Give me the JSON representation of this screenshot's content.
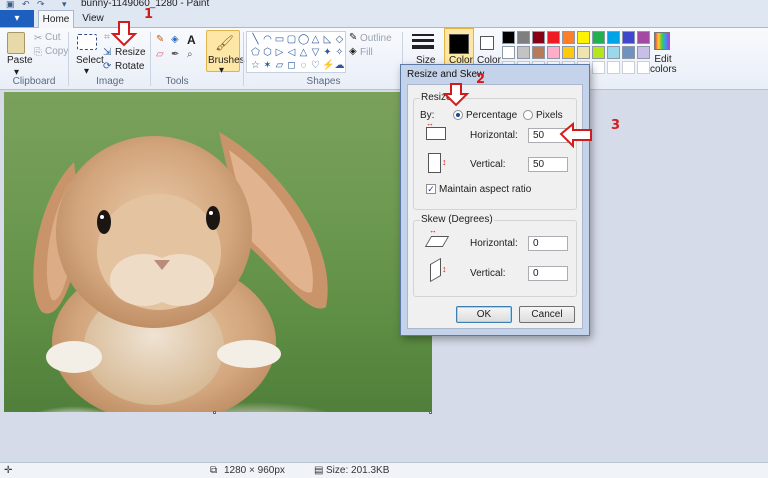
{
  "window": {
    "title": "bunny-1149060_1280 - Paint"
  },
  "tabs": {
    "file_label": "▾",
    "home": "Home",
    "view": "View"
  },
  "ribbon": {
    "clipboard": {
      "paste": "Paste",
      "cut": "Cut",
      "copy": "Copy",
      "label": "Clipboard"
    },
    "image": {
      "select": "Select",
      "crop_icon": "crop-icon",
      "resize": "Resize",
      "rotate": "Rotate",
      "label": "Image"
    },
    "tools": {
      "label": "Tools"
    },
    "brushes": {
      "label": "Brushes"
    },
    "shapes": {
      "outline": "Outline",
      "fill": "Fill",
      "label": "Shapes"
    },
    "size": {
      "label": "Size"
    },
    "colors": {
      "color1": "Color",
      "color2": "Color",
      "edit": "Edit colors",
      "row1": [
        "#000000",
        "#7f7f7f",
        "#880015",
        "#ed1c24",
        "#ff7f27",
        "#fff200",
        "#22b14c",
        "#00a2e8",
        "#3f48cc",
        "#a349a4"
      ],
      "row2": [
        "#ffffff",
        "#c3c3c3",
        "#b97a57",
        "#ffaec9",
        "#ffc90e",
        "#efe4b0",
        "#b5e61d",
        "#99d9ea",
        "#7092be",
        "#c8bfe7"
      ]
    }
  },
  "statusbar": {
    "dimensions": "1280 × 960px",
    "size": "Size: 201.3KB"
  },
  "dialog": {
    "title": "Resize and Skew",
    "resize_legend": "Resize",
    "by_label": "By:",
    "percentage": "Percentage",
    "pixels": "Pixels",
    "horizontal_label": "Horizontal:",
    "horizontal_value": "50",
    "vertical_label": "Vertical:",
    "vertical_value": "50",
    "maintain_aspect": "Maintain aspect ratio",
    "skew_legend": "Skew (Degrees)",
    "skew_horizontal_label": "Horizontal:",
    "skew_horizontal_value": "0",
    "skew_vertical_label": "Vertical:",
    "skew_vertical_value": "0",
    "ok": "OK",
    "cancel": "Cancel"
  },
  "annotations": {
    "step1": "1",
    "step2": "2",
    "step3": "3"
  }
}
